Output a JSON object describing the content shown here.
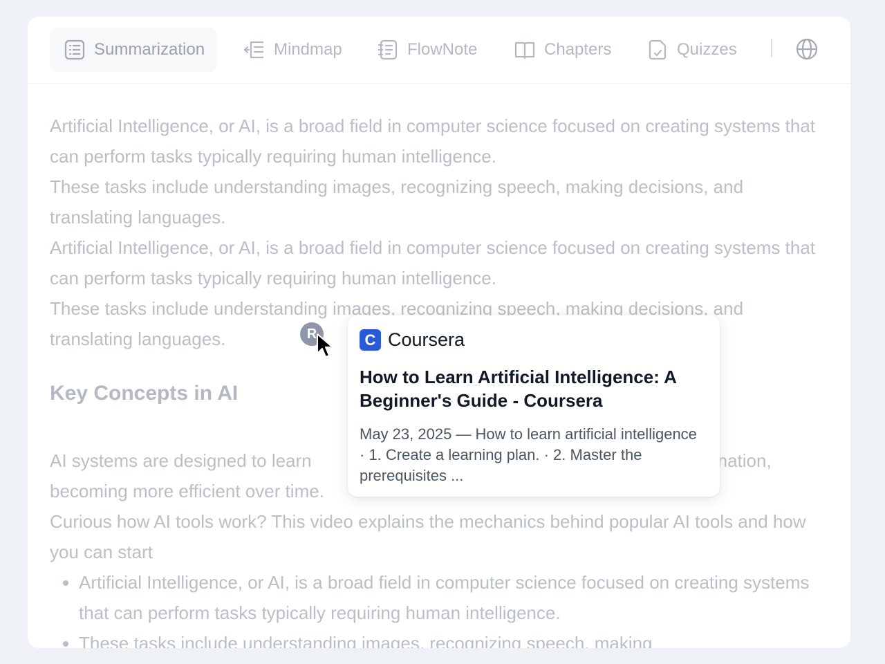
{
  "tabs": [
    {
      "label": "Summarization",
      "icon": "list-icon",
      "active": true
    },
    {
      "label": "Mindmap",
      "icon": "mindmap-icon",
      "active": false
    },
    {
      "label": "FlowNote",
      "icon": "note-icon",
      "active": false
    },
    {
      "label": "Chapters",
      "icon": "book-icon",
      "active": false
    },
    {
      "label": "Quizzes",
      "icon": "quiz-icon",
      "active": false
    }
  ],
  "content": {
    "paragraphs": [
      "Artificial Intelligence, or AI, is a broad field in computer science focused on creating systems that can perform tasks typically requiring human intelligence.",
      "These tasks include understanding images, recognizing speech, making decisions, and translating languages.",
      "Artificial Intelligence, or AI, is a broad field in computer science focused on creating systems that can perform tasks typically requiring human intelligence.",
      "These tasks include understanding images, recognizing speech, making decisions, and translating languages."
    ],
    "reference_badge": "R",
    "heading": "Key Concepts in AI",
    "paragraph_partial": "AI systems are designed to learn",
    "paragraph_partial_end": "nation,",
    "paragraph_partial_2": "becoming more efficient over time.",
    "paragraph_curious": "Curious how AI tools work? This video explains the mechanics behind popular AI tools and how you can start",
    "bullets": [
      "Artificial Intelligence, or AI, is a broad field in computer science focused on creating systems that can perform tasks typically requiring human intelligence.",
      " These tasks include understanding images, recognizing speech, making"
    ]
  },
  "popup": {
    "logo_letter": "C",
    "source": "Coursera",
    "title": "How to Learn Artificial Intelligence: A Beginner's Guide - Coursera",
    "snippet": "May 23, 2025 — How to learn artificial intelligence · 1. Create a learning plan. · 2. Master the prerequisites ..."
  },
  "colors": {
    "background": "#eef1f5",
    "coursera_blue": "#2a5ad7",
    "faded_text": "#b9bec7"
  }
}
